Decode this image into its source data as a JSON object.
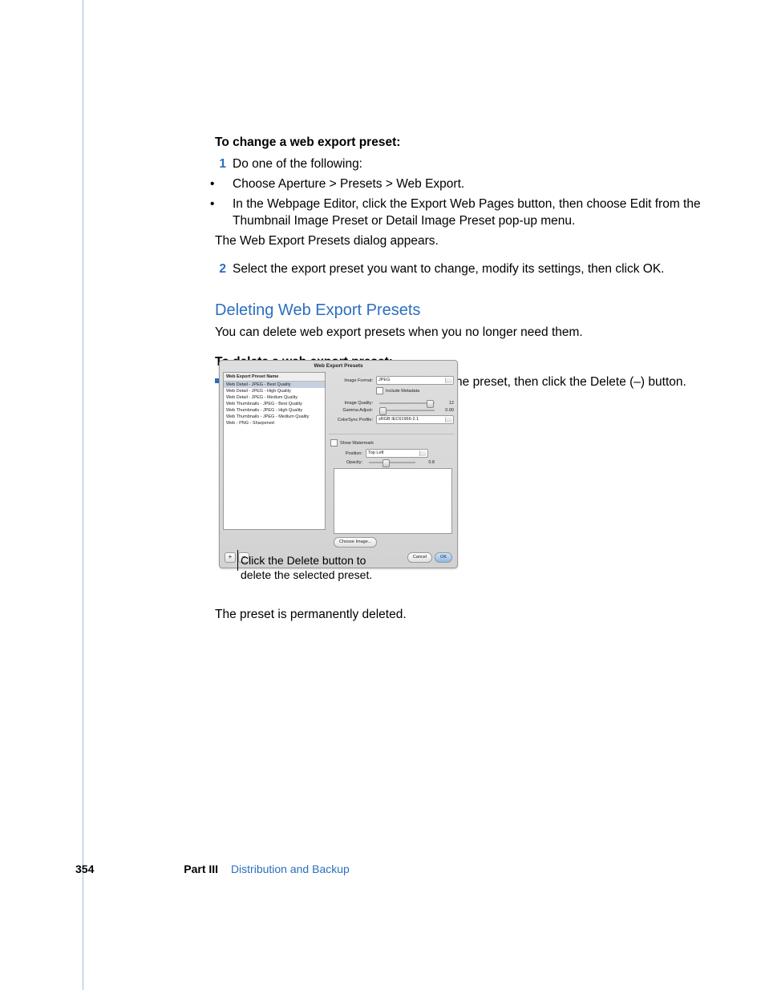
{
  "section1": {
    "heading": "To change a web export preset:",
    "step1_num": "1",
    "step1": "Do one of the following:",
    "bullet_a": "Choose Aperture > Presets > Web Export.",
    "bullet_b": "In the Webpage Editor, click the Export Web Pages button, then choose Edit from the Thumbnail Image Preset or Detail Image Preset pop-up menu.",
    "appears": "The Web Export Presets dialog appears.",
    "step2_num": "2",
    "step2": "Select the export preset you want to change, modify its settings, then click OK."
  },
  "section2": {
    "title": "Deleting Web Export Presets",
    "intro": "You can delete web export presets when you no longer need them.",
    "heading": "To delete a web export preset:",
    "bullet": "In the Web Export Presets dialog, select the preset, then click the Delete (–) button."
  },
  "dialog": {
    "title": "Web Export Presets",
    "list_header": "Web Export Preset Name",
    "presets": [
      "Web Detail - JPEG - Best Quality",
      "Web Detail - JPEG - High Quality",
      "Web Detail - JPEG - Medium Quality",
      "Web Thumbnails - JPEG - Best Quality",
      "Web Thumbnails - JPEG - High Quality",
      "Web Thumbnails - JPEG - Medium Quality",
      "Web - PNG - Sharpened"
    ],
    "labels": {
      "image_format": "Image Format:",
      "include_metadata": "Include Metadata",
      "image_quality": "Image Quality:",
      "gamma_adjust": "Gamma Adjust:",
      "colorsync": "ColorSync Profile:",
      "show_wm": "Show Watermark",
      "position": "Position:",
      "opacity": "Opacity:",
      "choose_image": "Choose Image...",
      "cancel": "Cancel",
      "ok": "OK"
    },
    "values": {
      "image_format": "JPEG",
      "image_quality": "12",
      "gamma_adjust": "0.00",
      "colorsync": "sRGB IEC61966-2.1",
      "position": "Top Left",
      "opacity": "0.8"
    },
    "plus": "+",
    "minus": "−"
  },
  "callout": "Click the Delete button to delete the selected preset.",
  "after": "The preset is permanently deleted.",
  "footer": {
    "page": "354",
    "part": "Part III",
    "section": "Distribution and Backup"
  }
}
